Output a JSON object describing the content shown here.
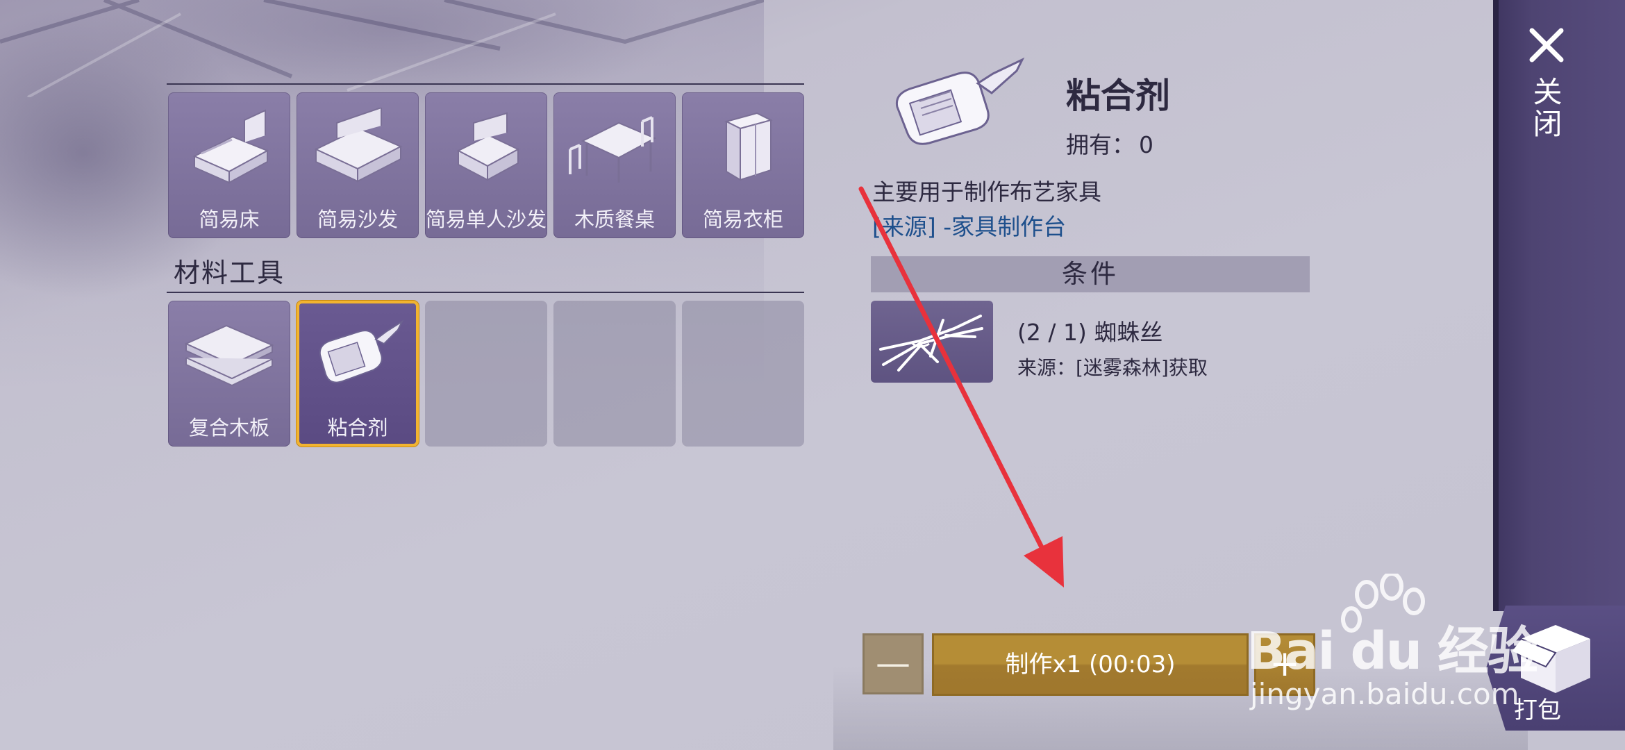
{
  "furniture_items": [
    {
      "label": "简易床",
      "icon": "bed-icon"
    },
    {
      "label": "简易沙发",
      "icon": "sofa-icon"
    },
    {
      "label": "简易单人沙发",
      "icon": "armchair-icon"
    },
    {
      "label": "木质餐桌",
      "icon": "dining-table-icon"
    },
    {
      "label": "简易衣柜",
      "icon": "wardrobe-icon"
    }
  ],
  "materials_section": {
    "title": "材料工具",
    "items": [
      {
        "label": "复合木板",
        "icon": "wood-planks-icon"
      },
      {
        "label": "粘合剂",
        "icon": "glue-bottle-icon",
        "selected": true
      }
    ],
    "empty_slots": 3
  },
  "detail": {
    "name": "粘合剂",
    "owned_label": "拥有：",
    "owned_count": "0",
    "description": "主要用于制作布艺家具",
    "source": "[来源] -家具制作台",
    "conditions_header": "条件",
    "requirement": {
      "icon": "spider-silk-icon",
      "text": "(2 / 1) 蜘蛛丝",
      "source": "来源：[迷雾森林]获取"
    }
  },
  "craft": {
    "minus_label": "—",
    "button_label": "制作x1 (00:03)",
    "plus_label": "+"
  },
  "close": {
    "label": "关闭",
    "icon": "close-icon"
  },
  "pack": {
    "label": "打包",
    "icon": "package-icon"
  },
  "watermark": {
    "logo": "Bai du 经验",
    "url": "jingyan.baidu.com"
  },
  "colors": {
    "accent_gold": "#b58d36",
    "selected_border": "#f2b430",
    "tile_purple": "#8a7ea8",
    "panel_purple": "#4e4472",
    "link_blue": "#1d4f8c",
    "arrow_red": "#e8323c"
  }
}
